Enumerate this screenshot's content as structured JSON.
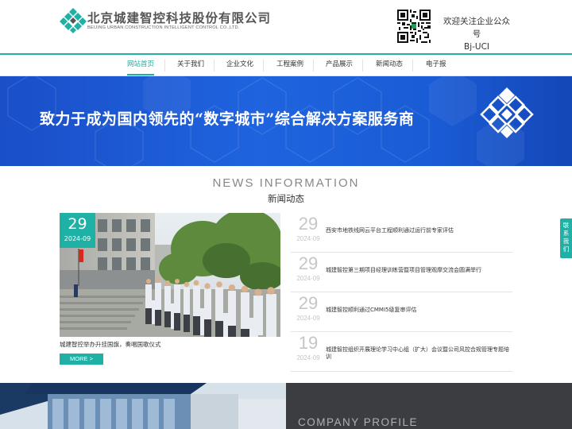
{
  "header": {
    "company_cn": "北京城建智控科技股份有限公司",
    "company_en": "BEIJING URBAN CONSTRUCTION INTELLIGENT CONTROL CO.,LTD.",
    "follow_text": "欢迎关注企业公众号",
    "account": "Bj-UCI"
  },
  "nav": {
    "items": [
      "网站首页",
      "关于我们",
      "企业文化",
      "工程案例",
      "产品展示",
      "新闻动态",
      "电子报"
    ],
    "active_index": 0
  },
  "banner": {
    "slogan": "致力于成为国内领先的“数字城市”综合解决方案服务商"
  },
  "news": {
    "title_en": "NEWS INFORMATION",
    "title_cn": "新闻动态",
    "featured": {
      "day": "29",
      "year_month": "2024-09",
      "caption": "城建智控举办升挂国旗，奏唱国歌仪式",
      "more_label": "MORE >"
    },
    "items": [
      {
        "day": "29",
        "year_month": "2024-09",
        "title": "西安市地铁线网云平台工程顺利通过运行前专家评估"
      },
      {
        "day": "29",
        "year_month": "2024-09",
        "title": "城建智控第三期项目经理训练营暨项目管理观摩交流会圆满举行"
      },
      {
        "day": "29",
        "year_month": "2024-09",
        "title": "城建智控顺利通过CMMI5级复审评估"
      },
      {
        "day": "19",
        "year_month": "2024-09",
        "title": "城建智控组织开展理论学习中心组（扩大）会议暨公司风控合规管理专题培训"
      }
    ]
  },
  "float_contact": {
    "label": "联系我们"
  },
  "profile": {
    "title": "COMPANY PROFILE"
  },
  "colors": {
    "accent": "#1fb0a6",
    "banner_blue": "#1f63de",
    "dark_panel": "#3b3d40"
  }
}
